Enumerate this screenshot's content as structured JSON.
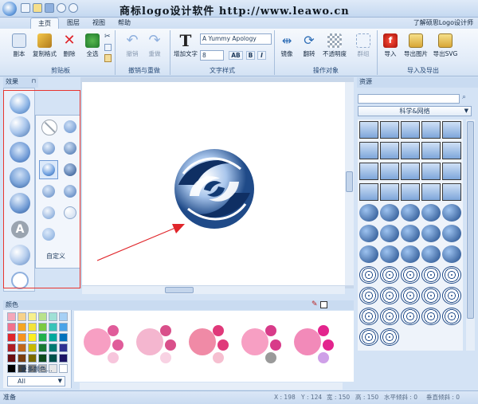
{
  "title_bar": {
    "title": "商标logo设计软件  http://www.leawo.cn"
  },
  "tabs": [
    "主页",
    "图层",
    "视图",
    "帮助"
  ],
  "help_link": "了解硕思Logo设计师",
  "ribbon": {
    "clipboard": {
      "label": "剪贴板",
      "buttons": [
        "副本",
        "复制格式",
        "删除",
        "全选"
      ]
    },
    "undo_redo": {
      "label": "撤销与重做",
      "buttons": [
        "撤销",
        "重做"
      ]
    },
    "text_style": {
      "label": "文字样式",
      "add_text": "增加文字",
      "font": "A Yummy Apology",
      "size": "8",
      "formats": [
        "AB",
        "B",
        "I"
      ]
    },
    "arrange": {
      "label": "操作对象",
      "buttons": [
        "镜像",
        "翻转",
        "不透明度",
        "群组"
      ]
    },
    "import_export": {
      "label": "导入及导出",
      "buttons": [
        "导入",
        "导出图片",
        "导出SVG"
      ]
    }
  },
  "left_panel": {
    "title": "效果",
    "custom_label": "自定义"
  },
  "resources": {
    "title": "资源",
    "category": "科学&网络"
  },
  "color_panel": {
    "title": "颜色",
    "more_colors": "更多颜色...",
    "filter": "All"
  },
  "palette_colors": [
    "#f4a7b9",
    "#f7d28a",
    "#f6f08c",
    "#b9e28c",
    "#9fe0d6",
    "#a6d0f5",
    "#f2728c",
    "#f5a623",
    "#f3e33a",
    "#7ac943",
    "#39c3b8",
    "#4aa3e8",
    "#e0262b",
    "#f7931e",
    "#fcee21",
    "#22b14c",
    "#00a99d",
    "#0071bc",
    "#b01e24",
    "#c1681b",
    "#c8b900",
    "#1a7a33",
    "#007a72",
    "#2e3192",
    "#6b0f12",
    "#7a3e10",
    "#7a6a00",
    "#0e4a1c",
    "#00504a",
    "#1b1464",
    "#000000",
    "#404040",
    "#808080",
    "#b3b3b3",
    "#e6e6e6",
    "#ffffff"
  ],
  "status": {
    "ready": "准备",
    "x": "X : 198",
    "y": "Y : 124",
    "w": "宽 : 150",
    "h": "高 : 150",
    "hskew": "水平倾斜 : 0",
    "vskew": "垂直倾斜 : 0"
  }
}
